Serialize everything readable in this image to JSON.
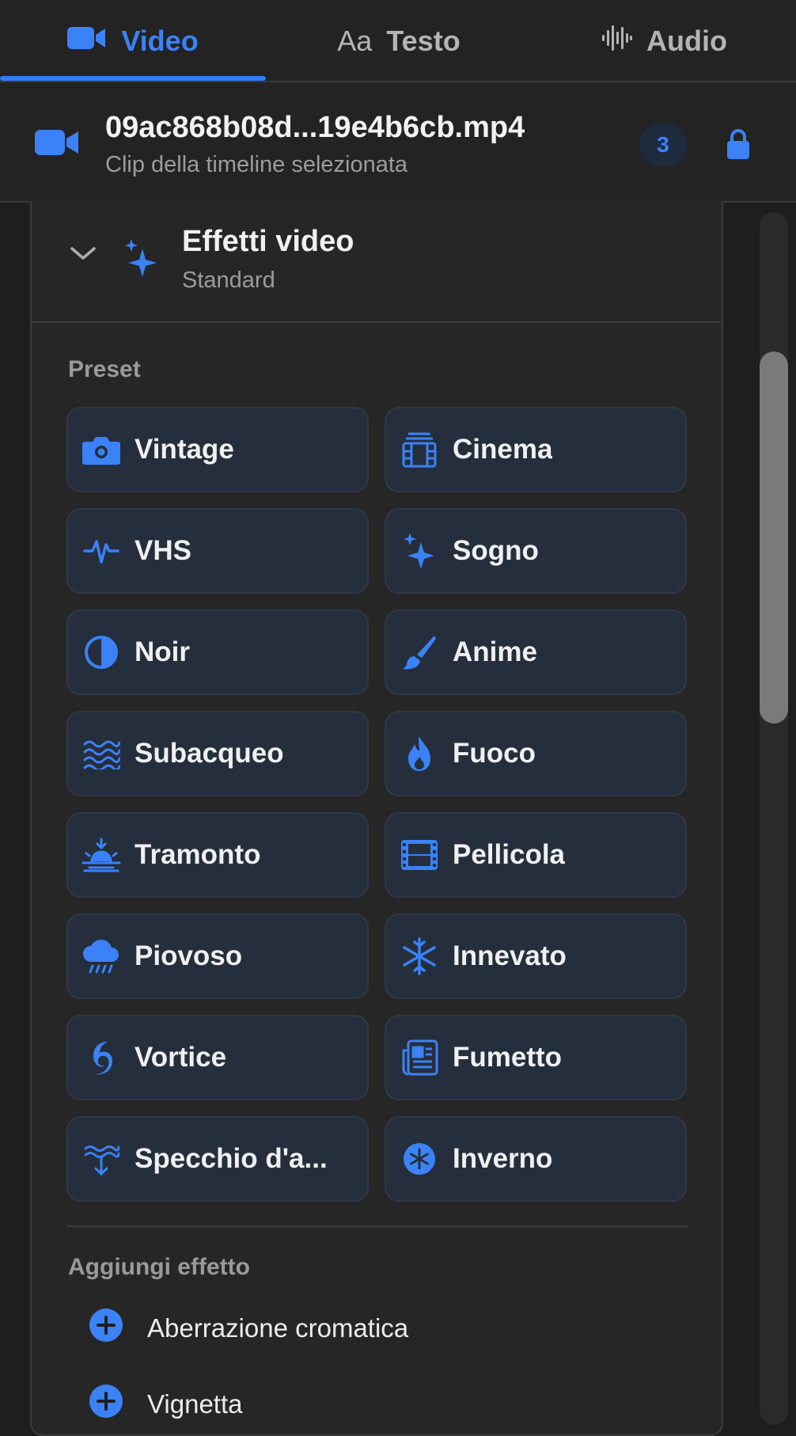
{
  "tabs": [
    {
      "label": "Video",
      "icon": "video-camera-icon",
      "active": true
    },
    {
      "label": "Testo",
      "icon": "text-aa-icon",
      "active": false
    },
    {
      "label": "Audio",
      "icon": "waveform-icon",
      "active": false
    }
  ],
  "text_tab_glyph": "Aa",
  "clip": {
    "name": "09ac868b08d...19e4b6cb.mp4",
    "subtitle": "Clip della timeline selezionata",
    "count": "3"
  },
  "section": {
    "title": "Effetti video",
    "subtitle": "Standard",
    "expanded": true
  },
  "presets_label": "Preset",
  "presets": [
    {
      "label": "Vintage",
      "icon": "camera-icon"
    },
    {
      "label": "Cinema",
      "icon": "film-frames-icon"
    },
    {
      "label": "VHS",
      "icon": "waveform-pulse-icon"
    },
    {
      "label": "Sogno",
      "icon": "sparkles-icon"
    },
    {
      "label": "Noir",
      "icon": "half-circle-icon"
    },
    {
      "label": "Anime",
      "icon": "paintbrush-icon"
    },
    {
      "label": "Subacqueo",
      "icon": "water-waves-icon"
    },
    {
      "label": "Fuoco",
      "icon": "flame-icon"
    },
    {
      "label": "Tramonto",
      "icon": "sunset-icon"
    },
    {
      "label": "Pellicola",
      "icon": "film-strip-icon"
    },
    {
      "label": "Piovoso",
      "icon": "cloud-rain-icon"
    },
    {
      "label": "Innevato",
      "icon": "snowflake-icon"
    },
    {
      "label": "Vortice",
      "icon": "hurricane-icon"
    },
    {
      "label": "Fumetto",
      "icon": "newspaper-icon"
    },
    {
      "label": "Specchio d'a...",
      "icon": "water-reflection-icon"
    },
    {
      "label": "Inverno",
      "icon": "snowflake-circle-icon"
    }
  ],
  "add_effect_label": "Aggiungi effetto",
  "add_effects": [
    {
      "label": "Aberrazione cromatica",
      "icon": "plus-circle-icon"
    },
    {
      "label": "Vignetta",
      "icon": "plus-circle-icon"
    }
  ],
  "colors": {
    "accent": "#3b82f6",
    "background": "#1e1e1e",
    "preset_bg": "#252e3c"
  }
}
